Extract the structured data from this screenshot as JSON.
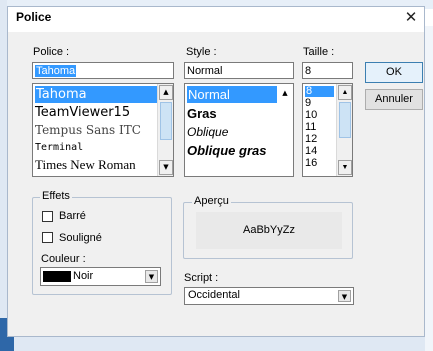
{
  "dialog": {
    "title": "Police",
    "close_glyph": "✕"
  },
  "font": {
    "label": "Police :",
    "value": "Tahoma",
    "items": [
      "Tahoma",
      "TeamViewer15",
      "Tempus Sans ITC",
      "Terminal",
      "Times New Roman"
    ],
    "selected_index": 0
  },
  "style": {
    "label": "Style :",
    "value": "Normal",
    "items": [
      "Normal",
      "Gras",
      "Oblique",
      "Oblique gras"
    ],
    "selected_index": 0
  },
  "size": {
    "label": "Taille :",
    "value": "8",
    "items": [
      "8",
      "9",
      "10",
      "11",
      "12",
      "14",
      "16"
    ],
    "selected_index": 0
  },
  "buttons": {
    "ok": "OK",
    "cancel": "Annuler"
  },
  "effects": {
    "title": "Effets",
    "strikeout": "Barré",
    "underline": "Souligné",
    "strikeout_checked": false,
    "underline_checked": false,
    "color_label": "Couleur :",
    "color_value": "Noir",
    "color_swatch": "#000000"
  },
  "preview": {
    "title": "Aperçu",
    "sample": "AaBbYyZz"
  },
  "script": {
    "label": "Script :",
    "value": "Occidental"
  },
  "icons": {
    "scroll_up": "▲",
    "scroll_down": "▼",
    "dropdown": "▼"
  },
  "colors": {
    "selection": "#3399ff",
    "dialog_bg": "#f0f0f0",
    "taskbar_accent": "#2e67a8"
  }
}
